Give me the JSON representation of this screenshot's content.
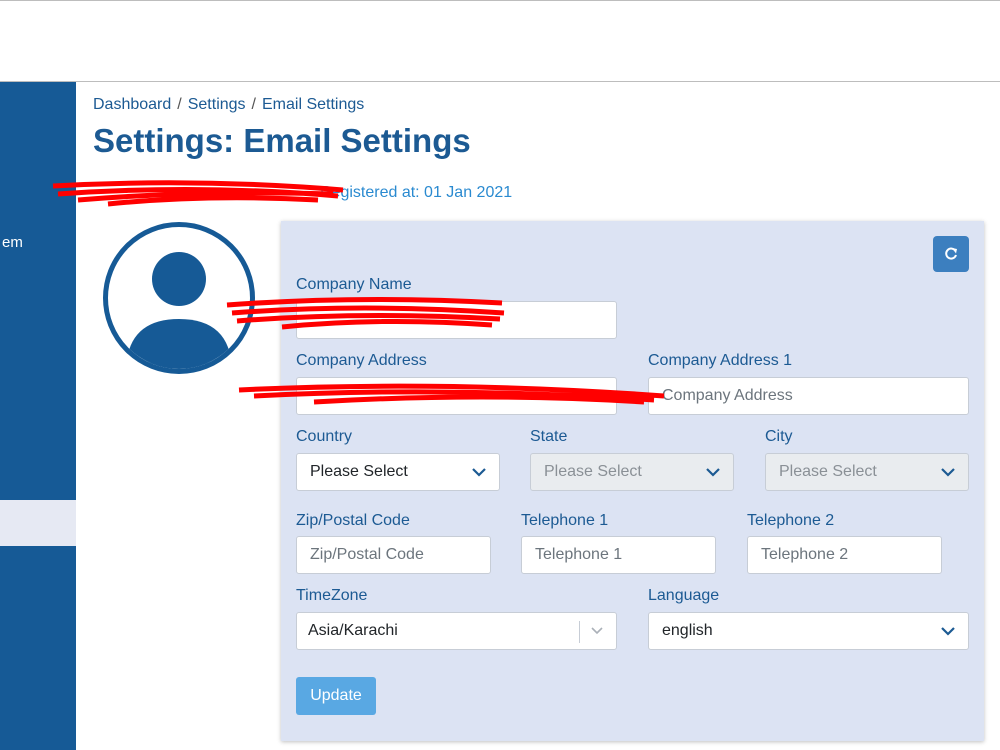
{
  "breadcrumb": [
    "Dashboard",
    "Settings",
    "Email Settings"
  ],
  "breadcrumb_separator": "/",
  "page_title": "Settings: Email Settings",
  "registered_text": "Registered at: 01 Jan 2021",
  "sidebar": {
    "partial_item": "em"
  },
  "form": {
    "company_name": {
      "label": "Company Name",
      "value": ""
    },
    "company_address": {
      "label": "Company Address",
      "value": ""
    },
    "company_address_1": {
      "label": "Company Address 1",
      "placeholder": "Company Address"
    },
    "country": {
      "label": "Country",
      "value": "Please Select"
    },
    "state": {
      "label": "State",
      "value": "Please Select"
    },
    "city": {
      "label": "City",
      "value": "Please Select"
    },
    "zip": {
      "label": "Zip/Postal Code",
      "placeholder": "Zip/Postal Code"
    },
    "telephone1": {
      "label": "Telephone 1",
      "placeholder": "Telephone 1"
    },
    "telephone2": {
      "label": "Telephone 2",
      "placeholder": "Telephone 2"
    },
    "timezone": {
      "label": "TimeZone",
      "value": "Asia/Karachi"
    },
    "language": {
      "label": "Language",
      "value": "english"
    },
    "update_label": "Update"
  },
  "colors": {
    "primary": "#1c5a93",
    "sidebar": "#165a96",
    "card": "#dce3f3",
    "update": "#59a8e3",
    "redaction": "#ff0000"
  },
  "icons": {
    "refresh": "refresh-icon",
    "avatar": "user-avatar-icon",
    "chevron": "chevron-down-icon"
  }
}
